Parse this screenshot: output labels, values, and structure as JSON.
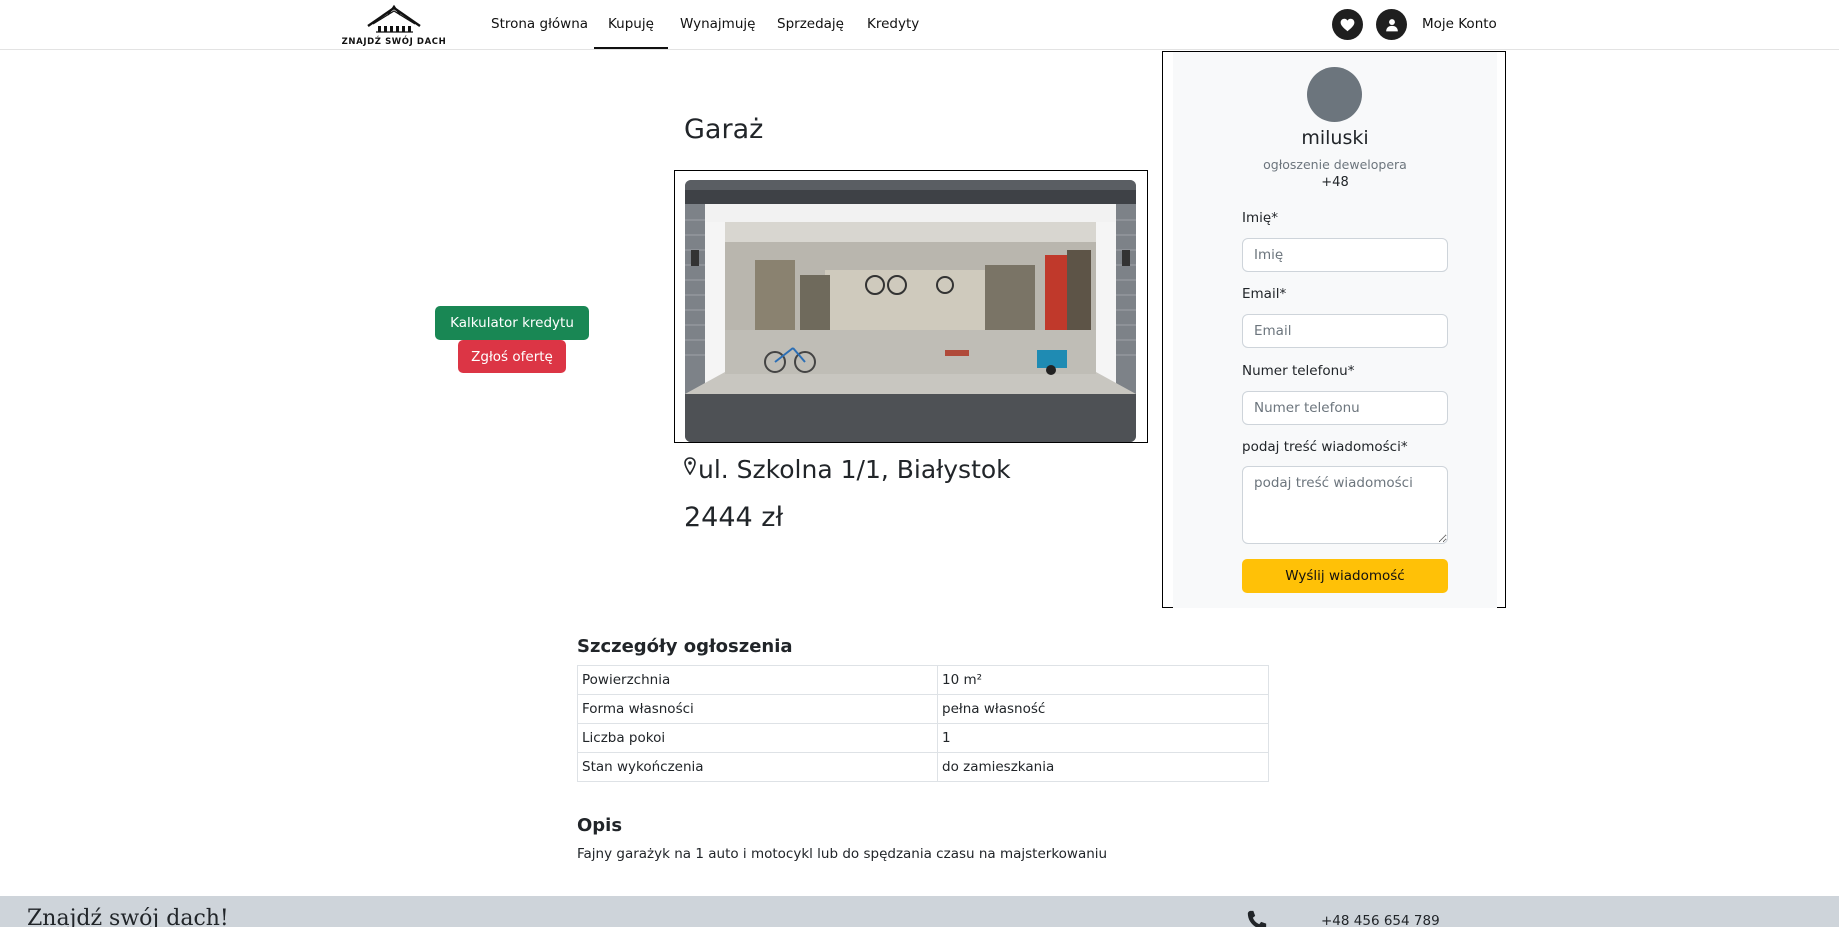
{
  "brand": {
    "logo_text": "ZNAJDŹ SWÓJ DACH"
  },
  "nav": {
    "items": [
      {
        "label": "Strona główna"
      },
      {
        "label": "Kupuję"
      },
      {
        "label": "Wynajmuję"
      },
      {
        "label": "Sprzedaję"
      },
      {
        "label": "Kredyty"
      }
    ],
    "active": "Kupuję",
    "account_label": "Moje Konto",
    "favorites_icon": "heart-icon",
    "account_icon": "user-icon"
  },
  "actions": {
    "loan_calculator_label": "Kalkulator kredytu",
    "report_offer_label": "Zgłoś ofertę"
  },
  "listing": {
    "title": "Garaż",
    "address": "ul. Szkolna 1/1, Białystok",
    "price": "2444 zł",
    "location_icon": "map-pin-icon",
    "photo": "garage-photo"
  },
  "contact": {
    "seller_name": "miluski",
    "seller_type": "ogłoszenie dewelopera",
    "seller_phone": "+48",
    "fields": {
      "name_label": "Imię*",
      "name_placeholder": "Imię",
      "email_label": "Email*",
      "email_placeholder": "Email",
      "phone_label": "Numer telefonu*",
      "phone_placeholder": "Numer telefonu",
      "message_label": "podaj treść wiadomości*",
      "message_placeholder": "podaj treść wiadomości"
    },
    "submit_label": "Wyślij wiadomość"
  },
  "details": {
    "heading": "Szczegóły ogłoszenia",
    "rows": [
      {
        "key": "Powierzchnia",
        "value": "10 m²"
      },
      {
        "key": "Forma własności",
        "value": "pełna własność"
      },
      {
        "key": "Liczba pokoi",
        "value": "1"
      },
      {
        "key": "Stan wykończenia",
        "value": "do zamieszkania"
      }
    ]
  },
  "description": {
    "heading": "Opis",
    "text": "Fajny garażyk na 1 auto i motocykl lub do spędzania czasu na majsterkowaniu"
  },
  "footer": {
    "brand": "Znajdź swój dach!",
    "phone": "+48 456 654 789",
    "phone_icon": "phone-icon"
  },
  "colors": {
    "green": "#198754",
    "red": "#dc3545",
    "yellow": "#ffc107",
    "avatar_gray": "#6c757d",
    "footer_bg": "#ced4da",
    "panel_bg": "#f8f9fa"
  }
}
